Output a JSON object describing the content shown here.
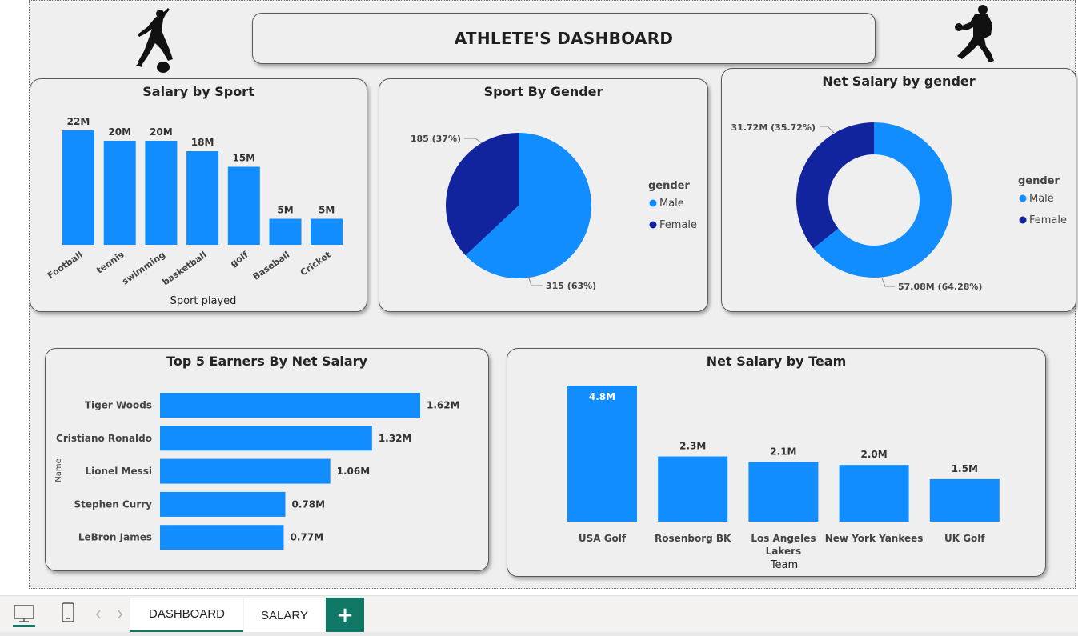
{
  "colors": {
    "male": "#118DFF",
    "female": "#12239E",
    "bar": "#118DFF",
    "accent": "#117865"
  },
  "dashboard": {
    "title": "ATHLETE'S DASHBOARD"
  },
  "salary_by_sport": {
    "title": "Salary by Sport",
    "xlabel": "Sport played",
    "categories": [
      "Football",
      "tennis",
      "swimming",
      "basketball",
      "golf",
      "Baseball",
      "Cricket"
    ],
    "labels": [
      "22M",
      "20M",
      "20M",
      "18M",
      "15M",
      "5M",
      "5M"
    ]
  },
  "sport_by_gender": {
    "title": "Sport By Gender",
    "legend_title": "gender",
    "legend": [
      "Male",
      "Female"
    ],
    "male_label": "315 (63%)",
    "female_label": "185 (37%)"
  },
  "net_salary_by_gender": {
    "title": "Net Salary by gender",
    "legend_title": "gender",
    "legend": [
      "Male",
      "Female"
    ],
    "male_label": "57.08M (64.28%)",
    "female_label": "31.72M (35.72%)"
  },
  "top5": {
    "title": "Top 5 Earners By Net Salary",
    "ylabel": "Name",
    "names": [
      "Tiger Woods",
      "Cristiano Ronaldo",
      "Lionel Messi",
      "Stephen Curry",
      "LeBron James"
    ],
    "labels": [
      "1.62M",
      "1.32M",
      "1.06M",
      "0.78M",
      "0.77M"
    ]
  },
  "team": {
    "title": "Net Salary by Team",
    "xlabel": "Team",
    "teams": [
      "USA Golf",
      "Rosenborg BK",
      "Los Angeles Lakers",
      "New York Yankees",
      "UK Golf"
    ],
    "labels": [
      "4.8M",
      "2.3M",
      "2.1M",
      "2.0M",
      "1.5M"
    ]
  },
  "tabs": {
    "dashboard": "DASHBOARD",
    "salary": "SALARY",
    "add": "+"
  },
  "chart_data": [
    {
      "type": "bar",
      "title": "Salary by Sport",
      "xlabel": "Sport played",
      "ylabel": "",
      "categories": [
        "Football",
        "tennis",
        "swimming",
        "basketball",
        "golf",
        "Baseball",
        "Cricket"
      ],
      "values": [
        22,
        20,
        20,
        18,
        15,
        5,
        5
      ],
      "unit": "M"
    },
    {
      "type": "pie",
      "title": "Sport By Gender",
      "categories": [
        "Male",
        "Female"
      ],
      "values": [
        315,
        185
      ],
      "percent": [
        63,
        37
      ],
      "legend": "right"
    },
    {
      "type": "pie",
      "title": "Net Salary by gender",
      "categories": [
        "Male",
        "Female"
      ],
      "values": [
        57.08,
        31.72
      ],
      "percent": [
        64.28,
        35.72
      ],
      "unit": "M",
      "donut": true,
      "legend": "right"
    },
    {
      "type": "bar",
      "orientation": "horizontal",
      "title": "Top 5 Earners By Net Salary",
      "ylabel": "Name",
      "categories": [
        "Tiger Woods",
        "Cristiano Ronaldo",
        "Lionel Messi",
        "Stephen Curry",
        "LeBron James"
      ],
      "values": [
        1.62,
        1.32,
        1.06,
        0.78,
        0.77
      ],
      "unit": "M"
    },
    {
      "type": "bar",
      "title": "Net Salary by Team",
      "xlabel": "Team",
      "categories": [
        "USA Golf",
        "Rosenborg BK",
        "Los Angeles Lakers",
        "New York Yankees",
        "UK Golf"
      ],
      "values": [
        4.8,
        2.3,
        2.1,
        2.0,
        1.5
      ],
      "unit": "M"
    }
  ]
}
